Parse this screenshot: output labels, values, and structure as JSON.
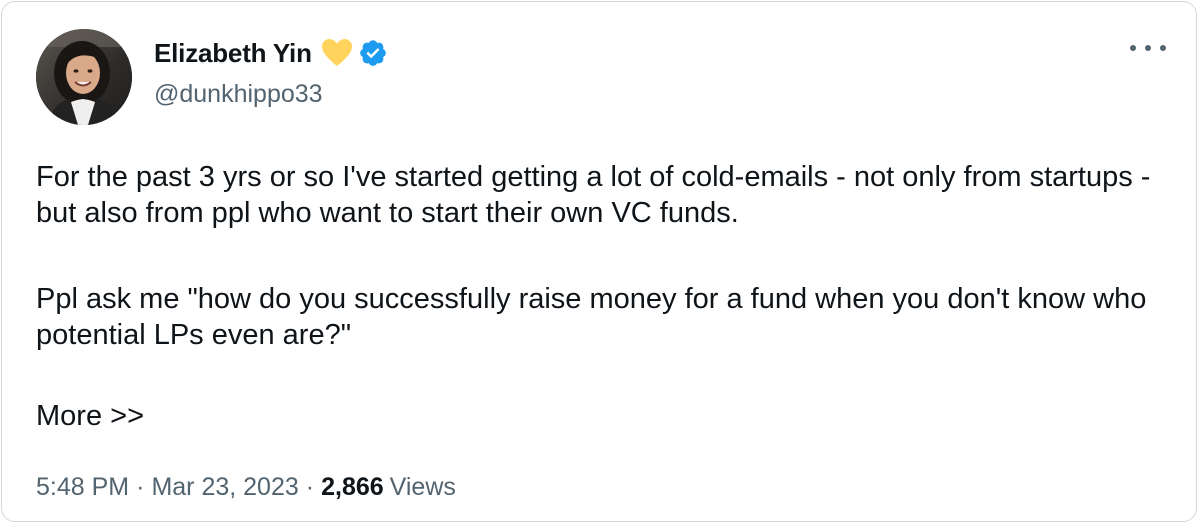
{
  "author": {
    "display_name": "Elizabeth Yin",
    "handle": "@dunkhippo33",
    "badges": [
      "yellow-heart-icon",
      "verified-badge-icon"
    ]
  },
  "tweet": {
    "paragraph_1": "For the past 3 yrs or so I've started getting a lot of cold-emails - not only from startups - but also from ppl who want to start their own VC funds.",
    "paragraph_2": "Ppl ask me \"how do you successfully raise money for a fund when you don't know who potential LPs even are?\"",
    "paragraph_3": "More >>"
  },
  "meta": {
    "time": "5:48 PM",
    "separator": "·",
    "date": "Mar 23, 2023",
    "views_count": "2,866",
    "views_label": "Views"
  },
  "colors": {
    "primary_text": "#0f1419",
    "secondary_text": "#536471",
    "verified_blue": "#1d9bf0",
    "heart_yellow": "#ffd35c",
    "border": "#cfd9de"
  }
}
